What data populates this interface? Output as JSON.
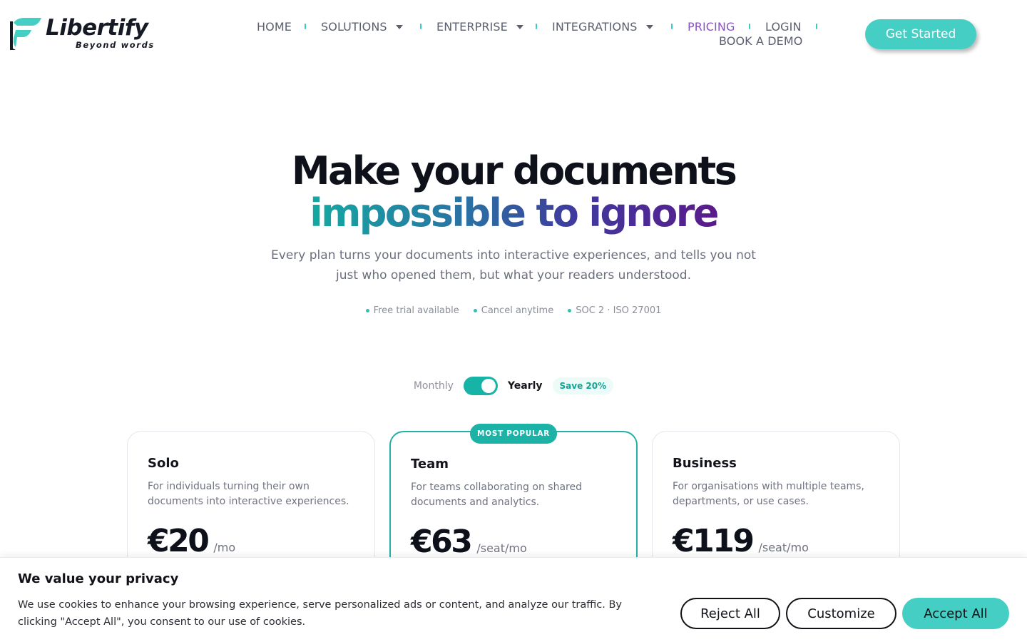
{
  "brand": {
    "name": "Libertify",
    "tagline": "Beyond words",
    "colors": {
      "teal": "#45cfc4",
      "purple": "#8a52c8",
      "dark": "#0f111a"
    }
  },
  "nav": {
    "home": "HOME",
    "solutions": "SOLUTIONS",
    "enterprise": "ENTERPRISE",
    "integrations": "INTEGRATIONS",
    "pricing": "PRICING",
    "login": "LOGIN",
    "book_demo": "BOOK A DEMO",
    "cta": "Get Started",
    "icons": {
      "dropdown": "caret-down-icon"
    }
  },
  "hero": {
    "title_line1": "Make your documents",
    "title_line2": "impossible to ignore",
    "subtitle": "Every plan turns your documents into interactive experiences, and tells you not just who opened them, but what your readers understood.",
    "badges": [
      "Free trial available",
      "Cancel anytime",
      "SOC 2 · ISO 27001"
    ]
  },
  "billing": {
    "monthly": "Monthly",
    "yearly": "Yearly",
    "selected": "Yearly",
    "save": "Save 20%"
  },
  "plans": [
    {
      "name": "Solo",
      "description": "For individuals turning their own documents into interactive experiences.",
      "price": "€20",
      "unit": "/mo"
    },
    {
      "name": "Team",
      "description": "For teams collaborating on shared documents and analytics.",
      "price": "€63",
      "unit": "/seat/mo",
      "badge": "MOST POPULAR"
    },
    {
      "name": "Business",
      "description": "For organisations with multiple teams, departments, or use cases.",
      "price": "€119",
      "unit": "/seat/mo"
    }
  ],
  "cookie": {
    "title": "We value your privacy",
    "text": "We use cookies to enhance your browsing experience, serve personalized ads or content, and analyze our traffic. By clicking \"Accept All\", you consent to our use of cookies.",
    "reject": "Reject All",
    "customize": "Customize",
    "accept": "Accept All"
  }
}
